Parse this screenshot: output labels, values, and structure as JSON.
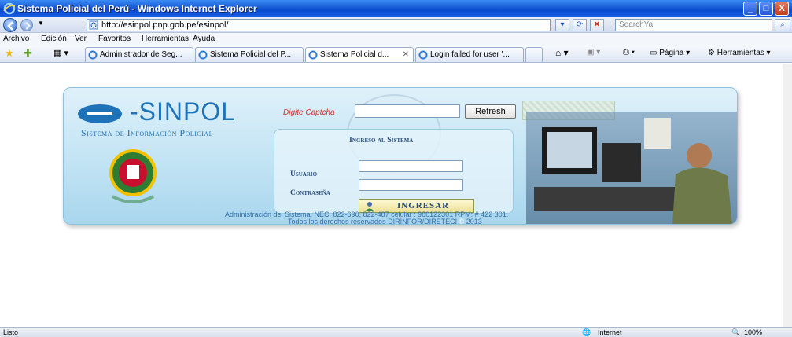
{
  "window": {
    "title": "Sistema Policial del Perú - Windows Internet Explorer"
  },
  "address": {
    "url": "http://esinpol.pnp.gob.pe/esinpol/",
    "search_placeholder": "SearchYa!"
  },
  "menu": [
    "Archivo",
    "Edición",
    "Ver",
    "Favoritos",
    "Herramientas",
    "Ayuda"
  ],
  "tabs": [
    {
      "label": "Administrador de Seg..."
    },
    {
      "label": "Sistema Policial del P..."
    },
    {
      "label": "Sistema Policial d..."
    },
    {
      "label": "Login failed for user '..."
    }
  ],
  "toolbar": {
    "page_label": "Página",
    "tools_label": "Herramientas"
  },
  "login": {
    "brand": "-SINPOL",
    "brand_sub": "Sistema de Información Policial",
    "captcha_label": "Digite Captcha",
    "refresh_label": "Refresh",
    "title": "Ingreso al Sistema",
    "user_label": "Usuario",
    "password_label": "Contraseña",
    "submit_label": "INGRESAR",
    "footer_line1": "Administración del Sistema: NEC: 822-690, 822-487 celular : 980122301 RPM: # 422 301.",
    "footer_line2": "Todos los derechos reservados DIRINFOR/DIRETECI",
    "footer_year": "2013"
  },
  "status": {
    "left": "Listo",
    "zone": "Internet",
    "zoom": "100%"
  },
  "colors": {
    "brand_blue": "#1e73b8",
    "captcha_red": "#d0302a",
    "panel_blue": "#bfe2f3"
  }
}
